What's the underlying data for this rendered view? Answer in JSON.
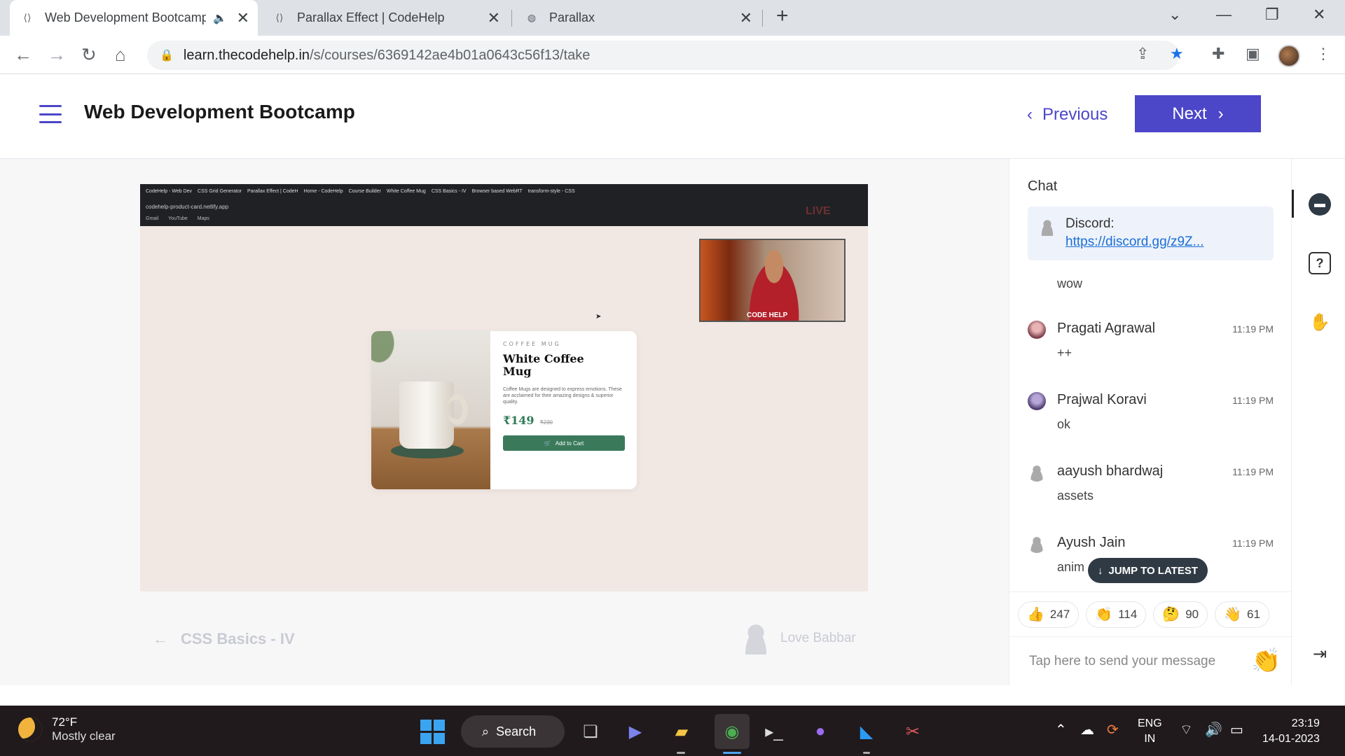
{
  "browser": {
    "tabs": [
      {
        "title": "Web Development Bootcamp",
        "active": true,
        "audio": true
      },
      {
        "title": "Parallax Effect | CodeHelp",
        "active": false
      },
      {
        "title": "Parallax",
        "active": false
      }
    ],
    "url_host": "learn.thecodehelp.in",
    "url_path": "/s/courses/6369142ae4b01a0643c56f13/take"
  },
  "header": {
    "course_title": "Web Development Bootcamp",
    "previous_label": "Previous",
    "next_label": "Next"
  },
  "video": {
    "inner_tabs": [
      "CodeHelp - Web Dev",
      "CSS Grid Generator",
      "Parallax Effect | CodeH",
      "Home - CodeHelp",
      "Course Builder",
      "White Coffee Mug",
      "CSS Basics - IV",
      "Browser based WebRT",
      "transform-style - CSS"
    ],
    "inner_url": "codehelp-product-card.netlify.app",
    "inner_bookmarks": [
      "Gmail",
      "YouTube",
      "Maps"
    ],
    "live_label": "LIVE",
    "webcam_text": "CODE HELP",
    "product": {
      "category": "COFFEE MUG",
      "name": "White Coffee Mug",
      "description": "Coffee Mugs are designed to express emotions. These are acclaimed for their amazing designs & superior quality.",
      "price": "₹149",
      "old_price": "₹230",
      "button": "Add to Cart"
    }
  },
  "lesson_nav": {
    "previous_lesson": "CSS Basics - IV",
    "instructor": "Love Babbar"
  },
  "chat": {
    "title": "Chat",
    "pinned_label": "Discord:",
    "pinned_link": "https://discord.gg/z9Z...",
    "first_message": "wow",
    "messages": [
      {
        "name": "Pragati Agrawal",
        "time": "11:19 PM",
        "text": "++"
      },
      {
        "name": "Prajwal Koravi",
        "time": "11:19 PM",
        "text": "ok"
      },
      {
        "name": "aayush bhardwaj",
        "time": "11:19 PM",
        "text": "assets"
      },
      {
        "name": "Ayush Jain",
        "time": "11:19 PM",
        "text": "anim"
      }
    ],
    "jump_label": "JUMP TO LATEST",
    "reactions": [
      {
        "emoji": "👍",
        "count": "247"
      },
      {
        "emoji": "👏",
        "count": "114"
      },
      {
        "emoji": "🤔",
        "count": "90"
      },
      {
        "emoji": "👋",
        "count": "61"
      }
    ],
    "composer_placeholder": "Tap here to send your message"
  },
  "taskbar": {
    "temperature": "72°F",
    "condition": "Mostly clear",
    "search_label": "Search",
    "lang_top": "ENG",
    "lang_bottom": "IN",
    "time": "23:19",
    "date": "14-01-2023"
  }
}
